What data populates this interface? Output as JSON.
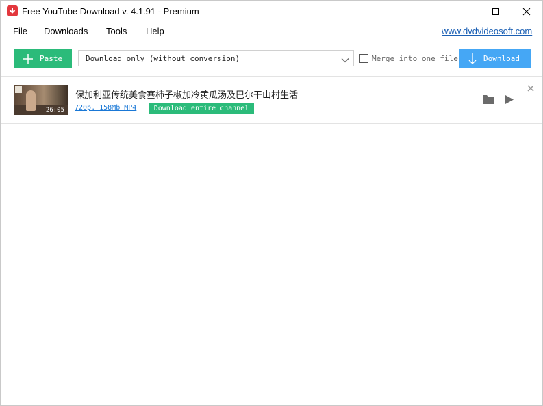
{
  "window": {
    "title": "Free YouTube Download v. 4.1.91 - Premium"
  },
  "menu": {
    "file": "File",
    "downloads": "Downloads",
    "tools": "Tools",
    "help": "Help",
    "site_link": "www.dvdvideosoft.com"
  },
  "toolbar": {
    "paste_label": "Paste",
    "mode_value": "Download only (without conversion)",
    "merge_label": "Merge into one file",
    "merge_checked": false,
    "download_label": "Download"
  },
  "items": [
    {
      "title": "保加利亚传统美食塞柿子椒加冷黄瓜汤及巴尔干山村生活",
      "meta": "720p, 158Mb MP4",
      "duration": "26:05",
      "channel_button": "Download entire channel"
    }
  ],
  "icons": {
    "app": "app-download-icon",
    "minimize": "minimize-icon",
    "maximize": "maximize-icon",
    "close": "close-icon",
    "paste": "plus-icon",
    "dropdown": "chevron-down-icon",
    "download": "arrow-down-icon",
    "folder": "folder-icon",
    "play": "play-icon",
    "remove": "remove-icon"
  },
  "colors": {
    "green_accent": "#2bbb7a",
    "blue_accent": "#45a7f5",
    "app_red": "#e3373d",
    "link_blue": "#1a5fb4"
  }
}
